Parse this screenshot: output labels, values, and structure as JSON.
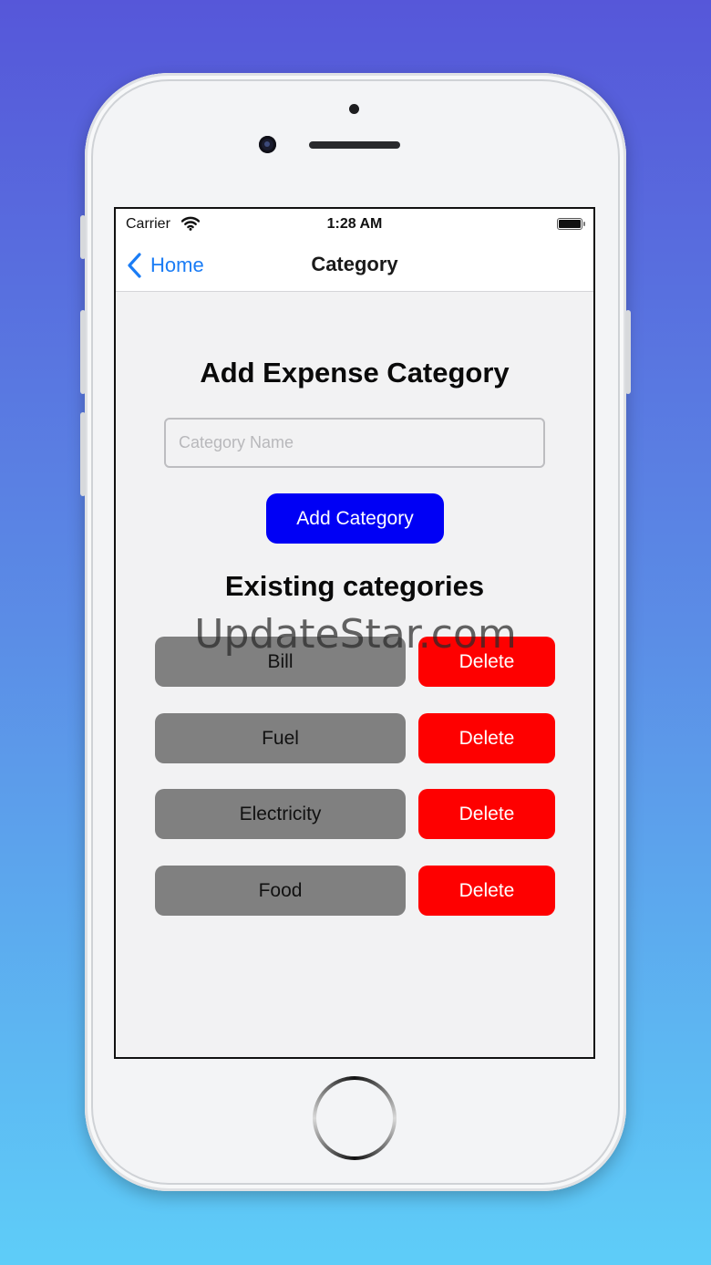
{
  "status_bar": {
    "carrier": "Carrier",
    "time": "1:28 AM"
  },
  "nav": {
    "back_label": "Home",
    "title": "Category"
  },
  "form": {
    "heading": "Add Expense Category",
    "input_placeholder": "Category Name",
    "input_value": "",
    "add_button_label": "Add Category"
  },
  "existing": {
    "heading": "Existing categories",
    "delete_label": "Delete",
    "categories": [
      {
        "name": "Bill"
      },
      {
        "name": "Fuel"
      },
      {
        "name": "Electricity"
      },
      {
        "name": "Food"
      }
    ]
  },
  "colors": {
    "accent_blue": "#1a7cf5",
    "add_button": "#0000f5",
    "delete_button": "#fe0000",
    "category_button": "#808080"
  },
  "watermark": "UpdateStar.com"
}
